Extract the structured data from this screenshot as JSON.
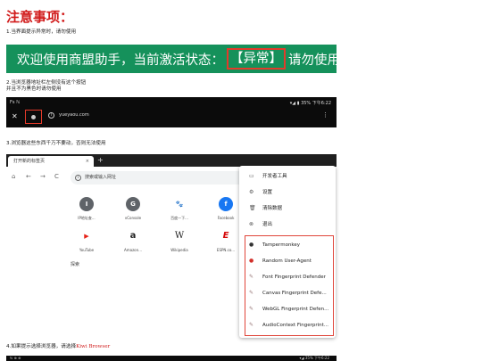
{
  "title": "注意事项：",
  "notes": {
    "n1": "1.当界面提示异常时，请勿使用",
    "n2a": "2.当浏览器地址栏左侧没有这个按钮",
    "n2b": "并且不为黑色时请勿使用",
    "n3": "3.浏览器这些东西千万不要动，否则无法使用",
    "n4_prefix": "4.如果提示选择浏览器，请选择",
    "n4_highlight": "Kiwi Browser"
  },
  "banner": {
    "pre": "欢迎使用商盟助手，当前激活状态：",
    "status": "【异常】",
    "post": "请勿使用"
  },
  "phone": {
    "status_left": "Fs ℕ",
    "status_right": "▾◢ ▮ 35%  下午6:22",
    "close": "✕",
    "info": "i",
    "url": "yueyaou.com",
    "menu": "⋮"
  },
  "browser": {
    "tab_title": "打开新的标签页",
    "tab_close": "×",
    "new_tab": "+",
    "back": "←",
    "forward": "→",
    "reload": "C",
    "home": "⌂",
    "omnibox_icon": "i",
    "omnibox_placeholder": "搜索或输入网址",
    "search_label": "探索",
    "tiles": [
      {
        "letter": "I",
        "label": "IP地址查...",
        "color": "#5f6368"
      },
      {
        "letter": "G",
        "label": "vConsole",
        "color": "#5f6368"
      },
      {
        "letter": "🐾",
        "label": "百度一下...",
        "color": "#2d5be3"
      },
      {
        "letter": "f",
        "label": "Facebook",
        "color": "#1877f2"
      },
      {
        "letter": "▶",
        "label": "YouTube",
        "color": "#e62117"
      },
      {
        "letter": "a",
        "label": "Amazon...",
        "color": "#ffffff"
      },
      {
        "letter": "W",
        "label": "Wikipedia",
        "color": "#ffffff"
      },
      {
        "letter": "E",
        "label": "ESPN.co...",
        "color": "#ffffff"
      }
    ]
  },
  "menu": {
    "items": [
      {
        "icon": "▭",
        "label": "开发者工具"
      },
      {
        "icon": "⚙",
        "label": "设置"
      },
      {
        "icon": "🗑",
        "label": "清除数据"
      },
      {
        "icon": "⊗",
        "label": "退出"
      }
    ],
    "extensions": [
      {
        "icon": "●",
        "label": "Tampermonkey"
      },
      {
        "icon": "●",
        "label": "Random User-Agent"
      },
      {
        "icon": "✎",
        "label": "Font Fingerprint Defender"
      },
      {
        "icon": "✎",
        "label": "Canvas Fingerprint Defe..."
      },
      {
        "icon": "✎",
        "label": "WebGL Fingerprint Defen..."
      },
      {
        "icon": "✎",
        "label": "AudioContext Fingerprint..."
      }
    ]
  },
  "bottom_status": {
    "left": "ℕ ⊕ ⊕",
    "right": "▾◢ 35%  下午6:22"
  },
  "colors": {
    "title_red": "#d11b1b",
    "banner_green": "#15915b",
    "highlight_red": "#e23b2b"
  }
}
